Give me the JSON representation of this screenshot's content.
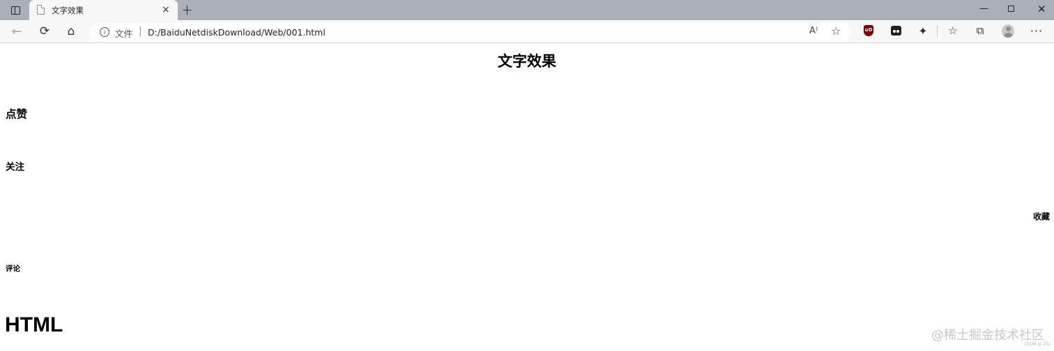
{
  "tab": {
    "title": "文字效果",
    "close": "×"
  },
  "newtab": "+",
  "window": {
    "minimize": "—",
    "close": "✕"
  },
  "toolbar": {
    "back": "←",
    "reload": "⟳",
    "home": "⌂",
    "address": {
      "info": "i",
      "file_label": "文件",
      "separator": "|",
      "url": "D:/BaiduNetdiskDownload/Web/001.html"
    },
    "read_aloud": "A⁾",
    "ublock": "uO",
    "more": "···"
  },
  "page": {
    "title": "文字效果",
    "like": "点赞",
    "follow": "关注",
    "collect": "收藏",
    "comment": "评论",
    "html": "HTML"
  },
  "watermark": {
    "text": "@稀土掘金技术社区",
    "small": "CSDN @ Zhi"
  },
  "icons": {
    "tab-actions": "tab-actions-icon",
    "doc": "document-icon",
    "back": "back-arrow-icon",
    "reload": "reload-icon",
    "home": "home-icon",
    "info": "info-icon",
    "read-aloud": "read-aloud-icon",
    "favorite-add": "star-plus-icon",
    "ublock": "ublock-origin-icon",
    "tampermonkey": "tampermonkey-icon",
    "extensions": "puzzle-icon",
    "favorites": "favorites-icon",
    "collections": "collections-icon",
    "profile": "profile-avatar-icon",
    "more": "more-icon"
  }
}
